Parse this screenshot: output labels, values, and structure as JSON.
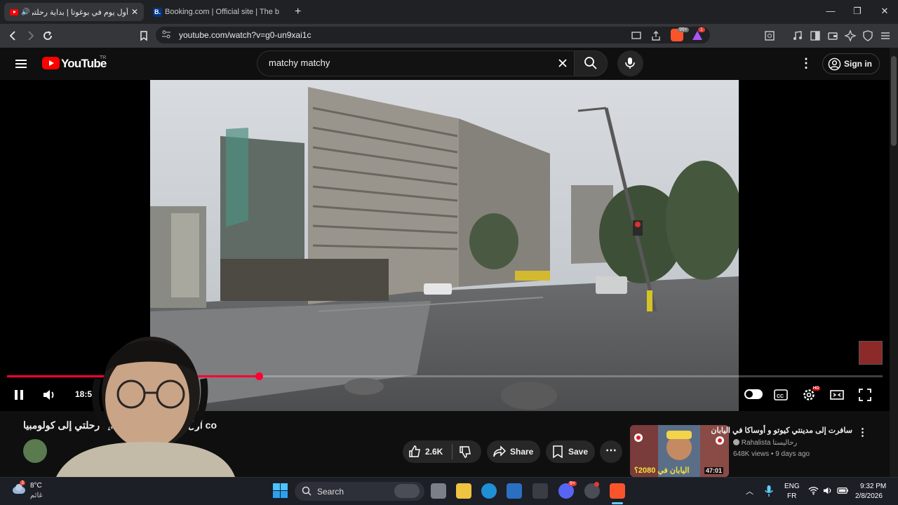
{
  "browser": {
    "tabs": [
      {
        "label": "أول يوم في بوغوتا | بداية رحلتي",
        "active": true
      },
      {
        "label": "Booking.com | Official site | The best",
        "active": false
      }
    ],
    "new_tab": "+",
    "url": "youtube.com/watch?v=g0-un9xai1c",
    "badge_brave": "99+",
    "badge_alert": "1"
  },
  "youtube": {
    "logo_text": "YouTube",
    "region": "TR",
    "search_value": "matchy matchy",
    "signin_label": "Sign in"
  },
  "player": {
    "time": "18:52",
    "progress": 0.288,
    "hd_badge": "HD"
  },
  "video": {
    "title": "أول يوم في بوغوتا | بداية رحلتي إلى كولومبيا co",
    "like_count": "2.6K",
    "share_label": "Share",
    "save_label": "Save",
    "more_label": "⋯"
  },
  "recommended": {
    "title": "سافرت إلى مدينتي كيوتو و أوساكا في اليابان",
    "channel": "Rahalista رحاليستا",
    "meta": "648K views • 9 days ago",
    "duration": "47:01",
    "thumb_caption": "اليابان في 2080؟"
  },
  "taskbar": {
    "weather_temp": "8°C",
    "weather_desc": "غائم",
    "weather_badge": "3",
    "search_label": "Search",
    "lang_primary": "ENG",
    "lang_secondary": "FR",
    "time": "9:32 PM",
    "date": "2/8/2026",
    "discord_badge": "9+"
  },
  "colors": {
    "accent_red": "#ff0033",
    "bg": "#0f0f0f"
  }
}
